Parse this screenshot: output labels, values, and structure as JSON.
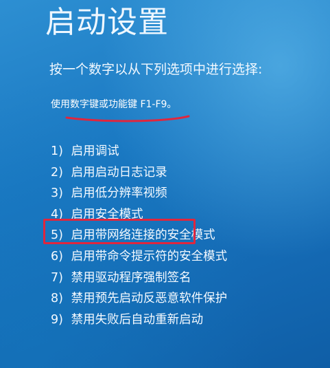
{
  "screen": {
    "title": "启动设置",
    "instruction": "按一个数字以从下列选项中进行选择:",
    "hint": "使用数字键或功能键 F1-F9。"
  },
  "options": [
    {
      "key": "1)",
      "label": "启用调试"
    },
    {
      "key": "2)",
      "label": "启用启动日志记录"
    },
    {
      "key": "3)",
      "label": "启用低分辨率视频"
    },
    {
      "key": "4)",
      "label": "启用安全模式"
    },
    {
      "key": "5)",
      "label": "启用带网络连接的安全模式"
    },
    {
      "key": "6)",
      "label": "启用带命令提示符的安全模式"
    },
    {
      "key": "7)",
      "label": "禁用驱动程序强制签名"
    },
    {
      "key": "8)",
      "label": "禁用预先启动反恶意软件保护"
    },
    {
      "key": "9)",
      "label": "禁用失败后自动重新启动"
    }
  ],
  "annotations": {
    "highlight_color": "#e0263d",
    "underline_color": "#e0263d",
    "highlighted_option": "4)"
  },
  "colors": {
    "background": "#1a78c2",
    "text": "#ffffff"
  }
}
